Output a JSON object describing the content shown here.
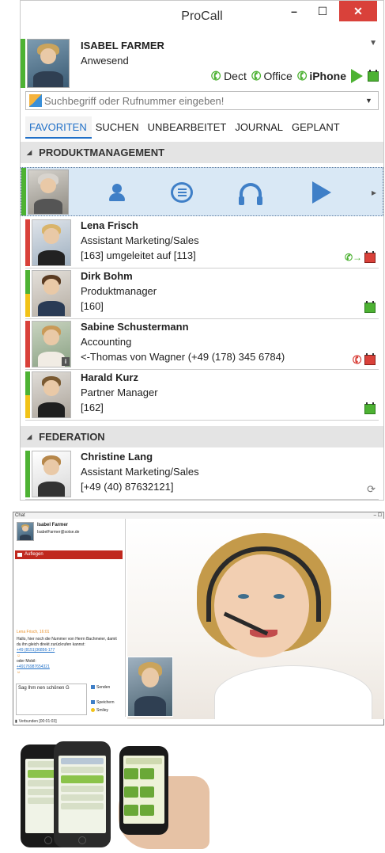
{
  "window": {
    "title": "ProCall",
    "minimize_label": "–",
    "maximize_label": "☐",
    "close_label": "✕"
  },
  "me": {
    "name": "ISABEL FARMER",
    "status": "Anwesend",
    "devices": [
      {
        "label": "Dect"
      },
      {
        "label": "Office"
      },
      {
        "label": "iPhone"
      }
    ]
  },
  "search": {
    "placeholder": "Suchbegriff oder Rufnummer eingeben!"
  },
  "tabs": [
    {
      "label": "FAVORITEN"
    },
    {
      "label": "SUCHEN"
    },
    {
      "label": "UNBEARBEITET"
    },
    {
      "label": "JOURNAL"
    },
    {
      "label": "GEPLANT"
    }
  ],
  "groups": {
    "produktmanagement": "PRODUKTMANAGEMENT",
    "federation": "FEDERATION"
  },
  "actions": [
    {
      "icon": "person-call-icon"
    },
    {
      "icon": "chat-icon"
    },
    {
      "icon": "headset-icon"
    },
    {
      "icon": "play-icon"
    }
  ],
  "contacts": [
    {
      "name": "Lena Frisch",
      "role": "Assistant Marketing/Sales",
      "info": "[163] umgeleitet auf [113]",
      "bar_top": "#d9413a",
      "bar_bottom": "#d9413a"
    },
    {
      "name": "Dirk Bohm",
      "role": "Produktmanager",
      "info": "[160]",
      "bar_top": "#4db233",
      "bar_bottom": "#f2c318"
    },
    {
      "name": "Sabine Schustermann",
      "role": "Accounting",
      "info": "<-Thomas von Wagner (+49 (178) 345 6784)",
      "bar_top": "#d9413a",
      "bar_bottom": "#d9413a"
    },
    {
      "name": "Harald Kurz",
      "role": "Partner Manager",
      "info": "[162]",
      "bar_top": "#4db233",
      "bar_bottom": "#f2c318"
    },
    {
      "name": "Christine Lang",
      "role": "Assistant Marketing/Sales",
      "info": "[+49 (40) 87632121]",
      "bar_top": "#4db233",
      "bar_bottom": "#4db233"
    }
  ],
  "chat": {
    "window_title": "Chat",
    "user_name": "Isabel Farmer",
    "user_email": "IsabelFarmer@sotse.de",
    "hangup_label": "Auflegen",
    "sender": "Lena Frisch, 16:01",
    "message": "Hallo, hier noch die Nummer von Herrn Bachmeier, damit du ihn gleich direkt zurückrufen kannst:",
    "link1": "+49 (8151)36856-177",
    "smiley1": "☺",
    "mobil_label": "oder Mobil:",
    "link2": "+4917698765432​1",
    "smiley2": "☺",
    "input_text": "Sag Ihm nen schönen G",
    "send_label": "Senden",
    "save_label": "Speichern",
    "smiley_label": "Smiley",
    "status": "Verbunden [00:01:03]"
  },
  "colors": {
    "available": "#4db233",
    "busy": "#d9413a",
    "away": "#f2c318",
    "accent": "#1f6fc7"
  }
}
